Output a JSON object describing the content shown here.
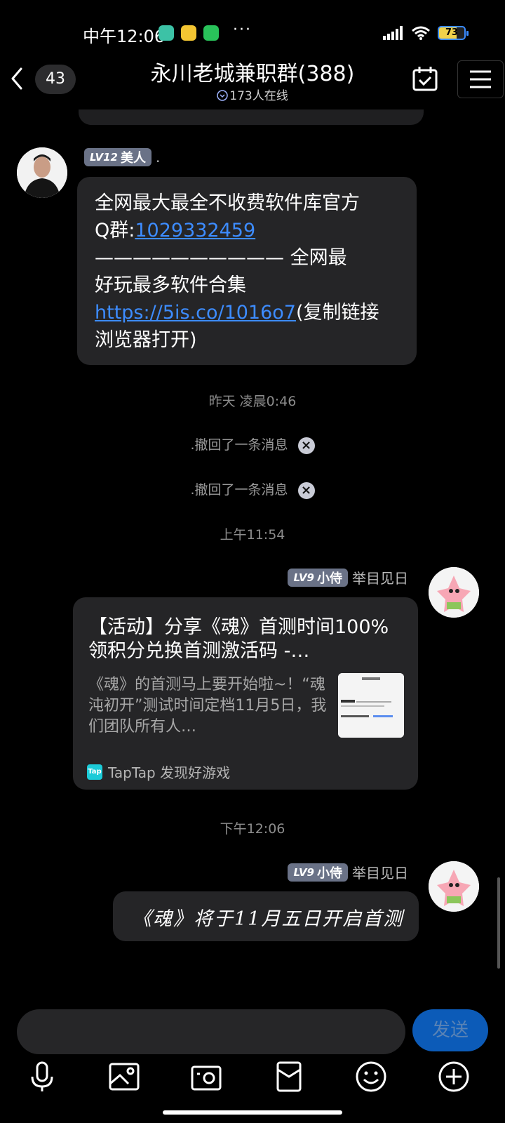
{
  "status_bar": {
    "time": "中午12:06",
    "dots": "···",
    "battery": "73"
  },
  "header": {
    "unread_count": "43",
    "title": "永川老城兼职群(388)",
    "online": "173人在线"
  },
  "messages": {
    "m1": {
      "level": "LV12",
      "title": "美人",
      "sender": ".",
      "line1": "全网最大最全不收费软件库官方",
      "qq_prefix": "Q群:",
      "qq_number": "1029332459",
      "dash_line": "—————————— 全网最",
      "line4": "好玩最多软件合集",
      "url": "https://5is.co/1016o7",
      "url_suffix": "(复制链接",
      "line6": "浏览器打开)"
    },
    "time1": "昨天 凌晨0:46",
    "recall1": ".撤回了一条消息",
    "recall2": ".撤回了一条消息",
    "time2": "上午11:54",
    "m2": {
      "level": "LV9",
      "title": "小侍",
      "sender": "举目见日",
      "card_title": "【活动】分享《魂》首测时间100%领积分兑换首测激活码 -…",
      "card_desc": "《魂》的首测马上要开始啦~！“魂沌初开”测试时间定档11月5日，我们团队所有人…",
      "card_source": "TapTap 发现好游戏",
      "logo_text": "Tap"
    },
    "time3": "下午12:06",
    "m3": {
      "level": "LV9",
      "title": "小侍",
      "sender": "举目见日",
      "text": "《魂》将于11月五日开启首测"
    }
  },
  "input": {
    "send_label": "发送"
  },
  "colors": {
    "background": "#000000",
    "bubble": "#252527",
    "link": "#3d8cff",
    "badge": "#6a7287",
    "send_button": "#0c5bb8"
  }
}
